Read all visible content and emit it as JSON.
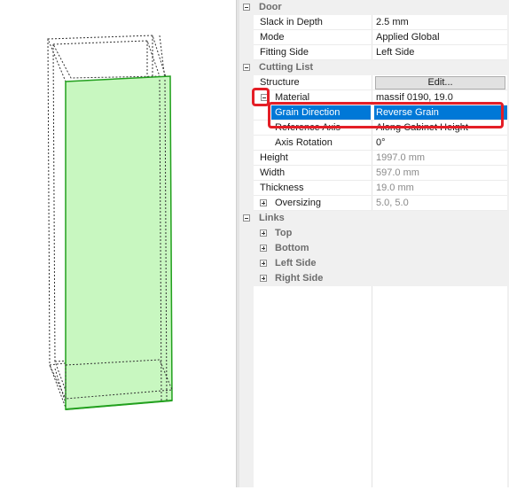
{
  "property_grid": {
    "door": {
      "label": "Door",
      "rows": [
        {
          "name": "Slack in Depth",
          "value": "2.5 mm"
        },
        {
          "name": "Mode",
          "value": "Applied Global"
        },
        {
          "name": "Fitting Side",
          "value": "Left Side"
        }
      ]
    },
    "cutting_list": {
      "label": "Cutting List",
      "structure": {
        "name": "Structure",
        "button": "Edit..."
      },
      "material": {
        "name": "Material",
        "value": "massif 0190, 19.0"
      },
      "grain_direction": {
        "name": "Grain Direction",
        "value": "Reverse Grain"
      },
      "reference_axis": {
        "name": "Reference Axis",
        "value": "Along Cabinet Height"
      },
      "axis_rotation": {
        "name": "Axis Rotation",
        "value": "0°"
      },
      "height": {
        "name": "Height",
        "value": "1997.0 mm"
      },
      "width": {
        "name": "Width",
        "value": "597.0 mm"
      },
      "thickness": {
        "name": "Thickness",
        "value": "19.0 mm"
      },
      "oversizing": {
        "name": "Oversizing",
        "value": "5.0, 5.0"
      }
    },
    "links": {
      "label": "Links",
      "items": [
        "Top",
        "Bottom",
        "Left Side",
        "Right Side"
      ]
    }
  },
  "colors": {
    "selection": "#0078d7",
    "highlight_annotation": "#e41e26",
    "panel_fill": "#c8f7c0",
    "panel_edge": "#22a01e"
  }
}
